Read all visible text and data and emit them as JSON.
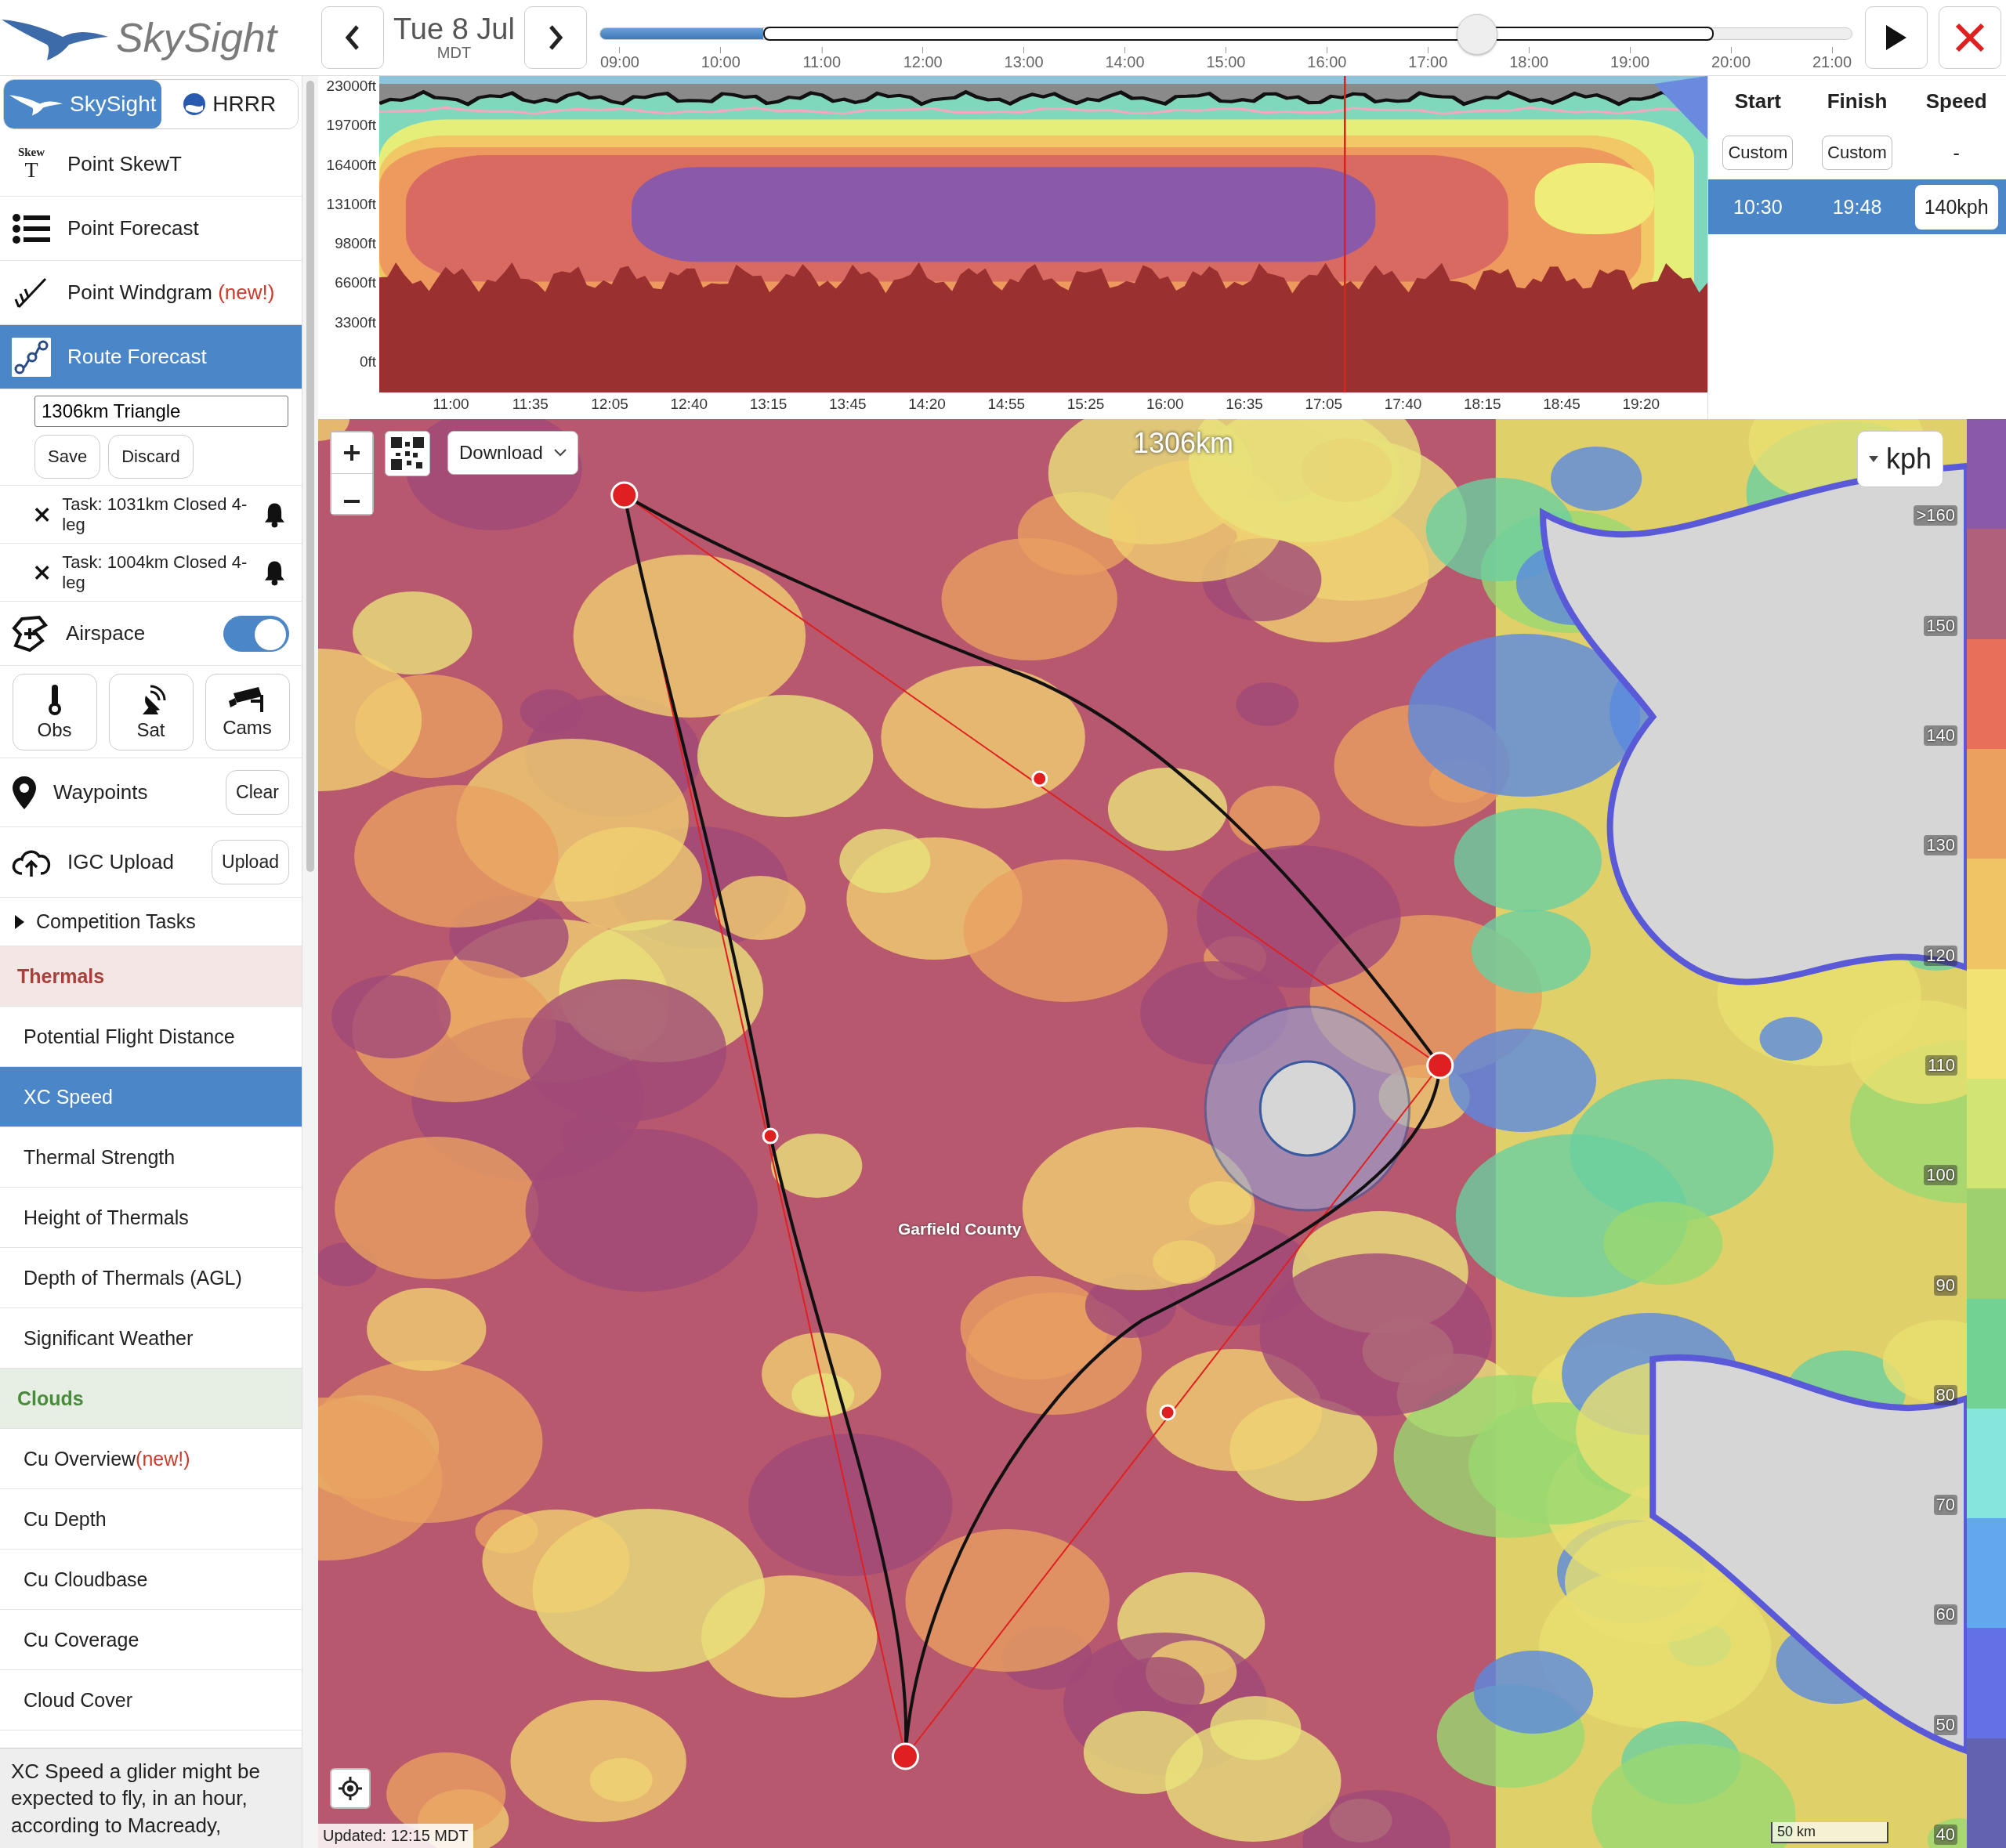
{
  "header": {
    "logo": "SkySight",
    "date": "Tue 8 Jul",
    "timezone": "MDT"
  },
  "timeline": {
    "ticks": [
      "09:00",
      "10:00",
      "11:00",
      "12:00",
      "13:00",
      "14:00",
      "15:00",
      "16:00",
      "17:00",
      "18:00",
      "19:00",
      "20:00",
      "21:00"
    ],
    "level": 0.7
  },
  "sidebar": {
    "model_tabs": [
      {
        "label": "SkySight",
        "kind": "bird",
        "selected": true
      },
      {
        "label": "HRRR",
        "kind": "noaa",
        "selected": false
      }
    ],
    "tools": [
      {
        "kind": "skewt",
        "label": "Point SkewT",
        "icon_top": "Skew",
        "icon_bottom": "T",
        "selected": false
      },
      {
        "kind": "list",
        "label": "Point Forecast",
        "selected": false
      },
      {
        "kind": "windbarb",
        "label": "Point Windgram",
        "badge": "(new!)",
        "selected": false
      },
      {
        "kind": "route",
        "label": "Route Forecast",
        "selected": true
      }
    ],
    "route_name": "1306km Triangle",
    "route_buttons": [
      "Save",
      "Discard"
    ],
    "tasks": [
      {
        "label": "Task: 1031km Closed 4-leg"
      },
      {
        "label": "Task: 1004km Closed 4-leg"
      }
    ],
    "airspace": {
      "label": "Airspace",
      "on": true
    },
    "observation_buttons": [
      {
        "kind": "thermometer",
        "label": "Obs"
      },
      {
        "kind": "satellite",
        "label": "Sat"
      },
      {
        "kind": "camera",
        "label": "Cams"
      }
    ],
    "waypoints": {
      "label": "Waypoints",
      "button": "Clear"
    },
    "igc": {
      "label": "IGC Upload",
      "button": "Upload"
    },
    "competition": {
      "label": "Competition Tasks",
      "expanded": false
    },
    "layer_groups": [
      {
        "title": "Thermals",
        "color": "#a8403a",
        "items": [
          {
            "label": "Potential Flight Distance",
            "selected": false
          },
          {
            "label": "XC Speed",
            "selected": true
          },
          {
            "label": "Thermal Strength",
            "selected": false
          },
          {
            "label": "Height of Thermals",
            "selected": false
          },
          {
            "label": "Depth of Thermals (AGL)",
            "selected": false
          },
          {
            "label": "Significant Weather",
            "selected": false
          }
        ]
      },
      {
        "title": "Clouds",
        "color": "#4a8a3c",
        "items": [
          {
            "label": "Cu Overview",
            "badge": "(new!)",
            "selected": false
          },
          {
            "label": "Cu Depth",
            "selected": false
          },
          {
            "label": "Cu Cloudbase",
            "selected": false
          },
          {
            "label": "Cu Coverage",
            "selected": false
          },
          {
            "label": "Cloud Cover",
            "selected": false
          }
        ]
      }
    ],
    "description": "XC Speed a glider might be expected to fly, in an hour, according to Macready,"
  },
  "cross_section": {
    "y_labels": [
      "23000ft",
      "19700ft",
      "16400ft",
      "13100ft",
      "9800ft",
      "6600ft",
      "3300ft",
      "0ft"
    ],
    "x_labels": [
      "11:00",
      "11:35",
      "12:05",
      "12:40",
      "13:15",
      "13:45",
      "14:20",
      "14:55",
      "15:25",
      "16:00",
      "16:35",
      "17:05",
      "17:40",
      "18:15",
      "18:45",
      "19:20"
    ]
  },
  "task_table": {
    "columns": [
      "Start",
      "Finish",
      "Speed"
    ],
    "rows": [
      {
        "selected": false,
        "cells": [
          {
            "kind": "button",
            "text": "Custom"
          },
          {
            "kind": "button",
            "text": "Custom"
          },
          {
            "kind": "text",
            "text": "-"
          }
        ]
      },
      {
        "selected": true,
        "cells": [
          {
            "kind": "text",
            "text": "10:30"
          },
          {
            "kind": "text",
            "text": "19:48"
          },
          {
            "kind": "box",
            "text": "140kph"
          }
        ]
      }
    ]
  },
  "map": {
    "download": "Download",
    "distance": "1306km",
    "unit": "kph",
    "place": "Garfield County",
    "updated": "Updated: 12:15 MDT",
    "scale": "50 km",
    "legend": [
      {
        "label": ">160",
        "color": "#8a5aa8"
      },
      {
        "label": "150",
        "color": "#b0607a"
      },
      {
        "label": "140",
        "color": "#e8705a"
      },
      {
        "label": "130",
        "color": "#eba060"
      },
      {
        "label": "120",
        "color": "#f0c464"
      },
      {
        "label": "110",
        "color": "#f2e274"
      },
      {
        "label": "100",
        "color": "#d2e474"
      },
      {
        "label": "90",
        "color": "#9ed070"
      },
      {
        "label": "80",
        "color": "#72d294"
      },
      {
        "label": "70",
        "color": "#86e6de"
      },
      {
        "label": "60",
        "color": "#62a8ee"
      },
      {
        "label": "50",
        "color": "#6470e6"
      },
      {
        "label": "40",
        "color": "#6262b0"
      }
    ]
  }
}
